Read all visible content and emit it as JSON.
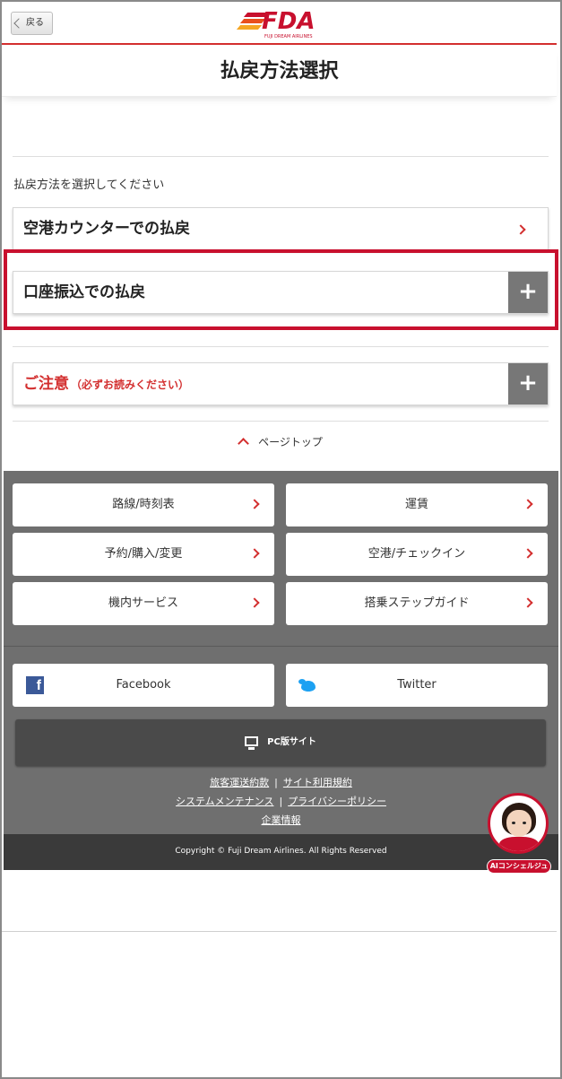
{
  "header": {
    "back_label": "戻る",
    "logo_text": "FDA",
    "logo_tagline": "FUJI DREAM AIRLINES"
  },
  "page": {
    "title": "払戻方法選択",
    "intro": "払戻方法を選択してください"
  },
  "options": [
    {
      "label": "空港カウンターでの払戻",
      "action": "chevron"
    },
    {
      "label": "口座振込での払戻",
      "action": "plus"
    }
  ],
  "notice": {
    "label": "ご注意",
    "sub": "（必ずお読みください）",
    "action": "+"
  },
  "plus_symbol": "+",
  "page_top": "ページトップ",
  "footer": {
    "nav": [
      {
        "label": "路線/時刻表"
      },
      {
        "label": "運賃"
      },
      {
        "label": "予約/購入/変更"
      },
      {
        "label": "空港/チェックイン"
      },
      {
        "label": "機内サービス"
      },
      {
        "label": "搭乗ステップガイド"
      }
    ],
    "facebook": "Facebook",
    "twitter": "Twitter",
    "pc_site": "PC版サイト",
    "links": {
      "terms_transport": "旅客運送約款",
      "terms_site": "サイト利用規約",
      "maintenance": "システムメンテナンス",
      "privacy": "プライバシーポリシー",
      "company": "企業情報",
      "separator": "|"
    },
    "copyright": "Copyright © Fuji Dream Airlines. All Rights Reserved"
  },
  "concierge": {
    "label": "AIコンシェルジュ"
  },
  "colors": {
    "brand_red": "#c8102e",
    "footer_gray": "#6f6f6f",
    "footer_dark": "#3a3a3a",
    "facebook": "#3b5998",
    "twitter": "#1da1f2"
  }
}
